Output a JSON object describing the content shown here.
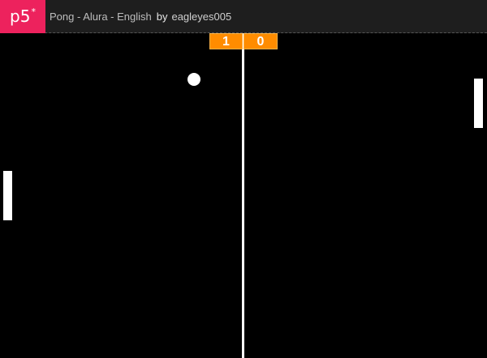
{
  "header": {
    "logo_text": "p5",
    "logo_superscript": "*",
    "sketch_title": "Pong - Alura - English",
    "by_label": "by",
    "author": "eagleyes005",
    "brand_color": "#ed225d"
  },
  "game": {
    "score_left": "1",
    "score_right": "0",
    "score_color": "#ff8c00"
  }
}
